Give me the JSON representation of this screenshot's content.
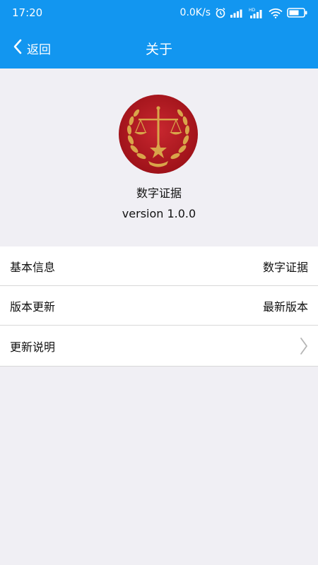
{
  "status_bar": {
    "time": "17:20",
    "network_speed": "0.0K/s",
    "icons": [
      "alarm-icon",
      "signal-icon",
      "hd-signal-icon",
      "wifi-icon",
      "battery-icon"
    ]
  },
  "navbar": {
    "back_label": "返回",
    "title": "关于"
  },
  "app": {
    "logo": "scales-of-justice-emblem",
    "name": "数字证据",
    "version": "version 1.0.0"
  },
  "settings": [
    {
      "label": "基本信息",
      "value": "数字证据"
    },
    {
      "label": "版本更新",
      "value": "最新版本"
    },
    {
      "label": "更新说明",
      "value": ""
    }
  ],
  "colors": {
    "header": "#1296f0",
    "background": "#f0eff4",
    "emblem_red": "#b51c24",
    "emblem_gold": "#d9a54a"
  }
}
